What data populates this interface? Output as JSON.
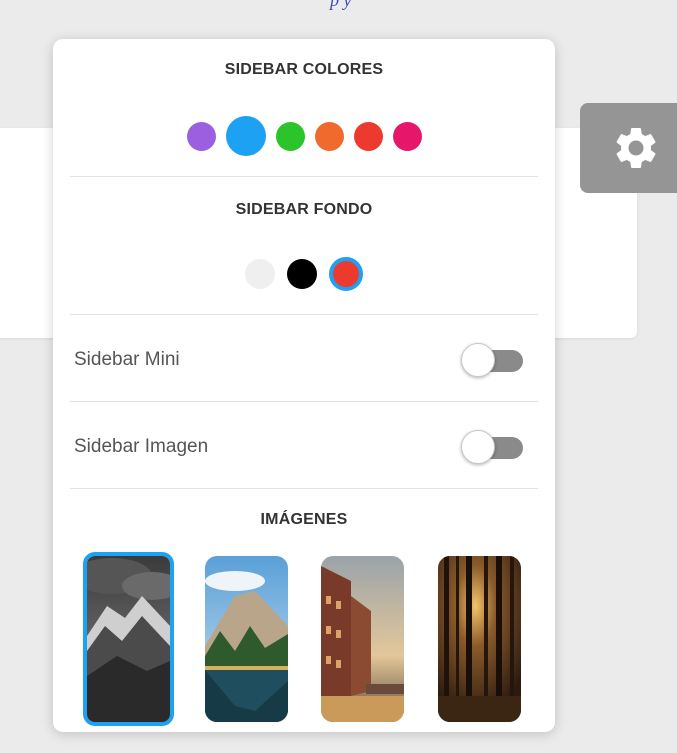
{
  "colors": {
    "accent": "#1da1f2",
    "sidebar_colors": [
      "#9c5fe0",
      "#1da1f2",
      "#2bc42b",
      "#f06a2e",
      "#ec3a2e",
      "#e6176b"
    ],
    "sidebar_backgrounds": [
      "#efefef",
      "#000000",
      "#ec3a2e"
    ]
  },
  "settings": {
    "colors_title": "SIDEBAR COLORES",
    "background_title": "SIDEBAR FONDO",
    "mini_label": "Sidebar Mini",
    "image_label": "Sidebar Imagen",
    "images_title": "IMÁGENES",
    "mini_enabled": false,
    "image_enabled": false,
    "selected_color_index": 1,
    "selected_background_index": 2,
    "selected_image_index": 0
  },
  "images": [
    {
      "name": "snowy-mountain"
    },
    {
      "name": "lake-forest-mountain"
    },
    {
      "name": "canal-city"
    },
    {
      "name": "forest-sunset"
    }
  ],
  "icons": {
    "gear": "gear-icon"
  }
}
